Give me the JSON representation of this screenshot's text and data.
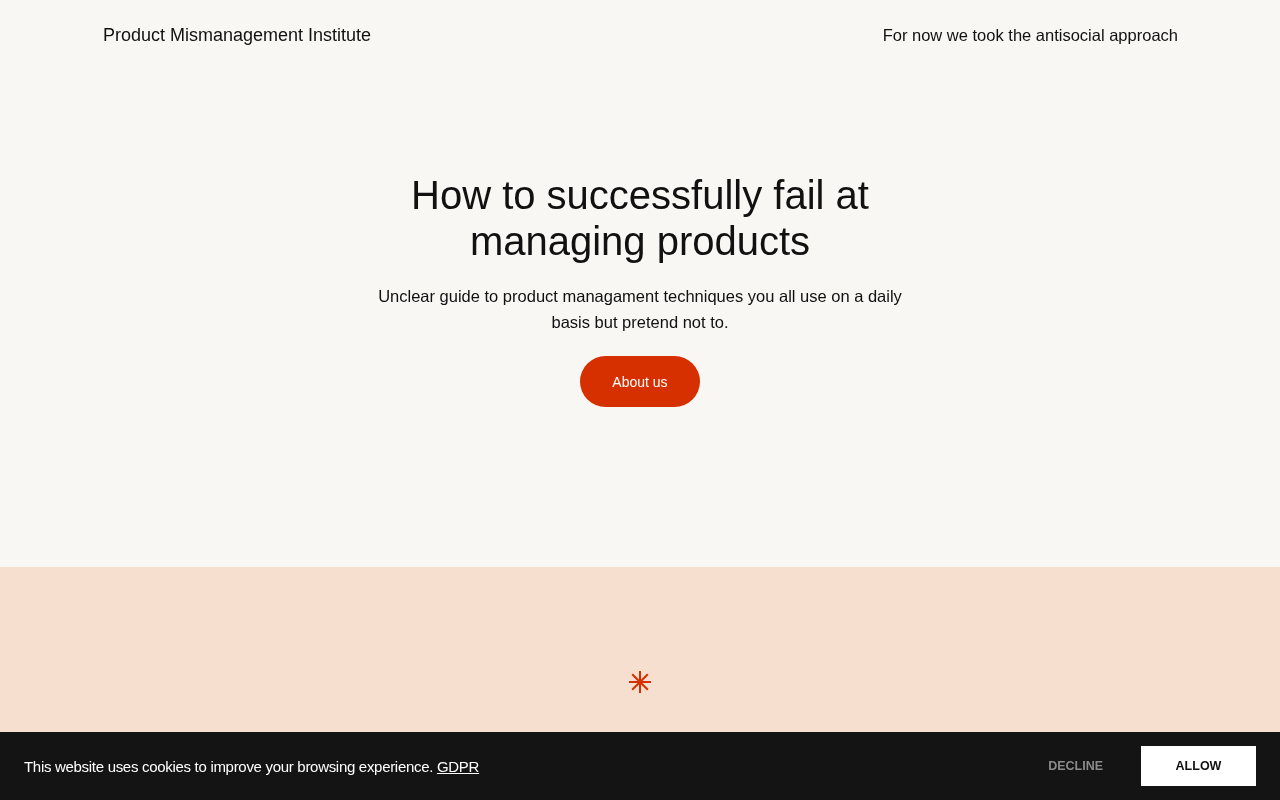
{
  "header": {
    "brand": "Product Mismanagement Institute",
    "tagline": "For now we took the antisocial approach"
  },
  "hero": {
    "title": "How to successfully fail at managing products",
    "subtitle": "Unclear guide to product managament techniques you all use on a daily basis but pretend not to.",
    "button": "About us"
  },
  "cookie_banner": {
    "message": "This website uses cookies to improve your browsing experience.",
    "link": "GDPR",
    "buttons": [
      {
        "label": "DECLINE",
        "kind": "secondary"
      },
      {
        "label": "ALLOW",
        "kind": "primary"
      }
    ]
  }
}
